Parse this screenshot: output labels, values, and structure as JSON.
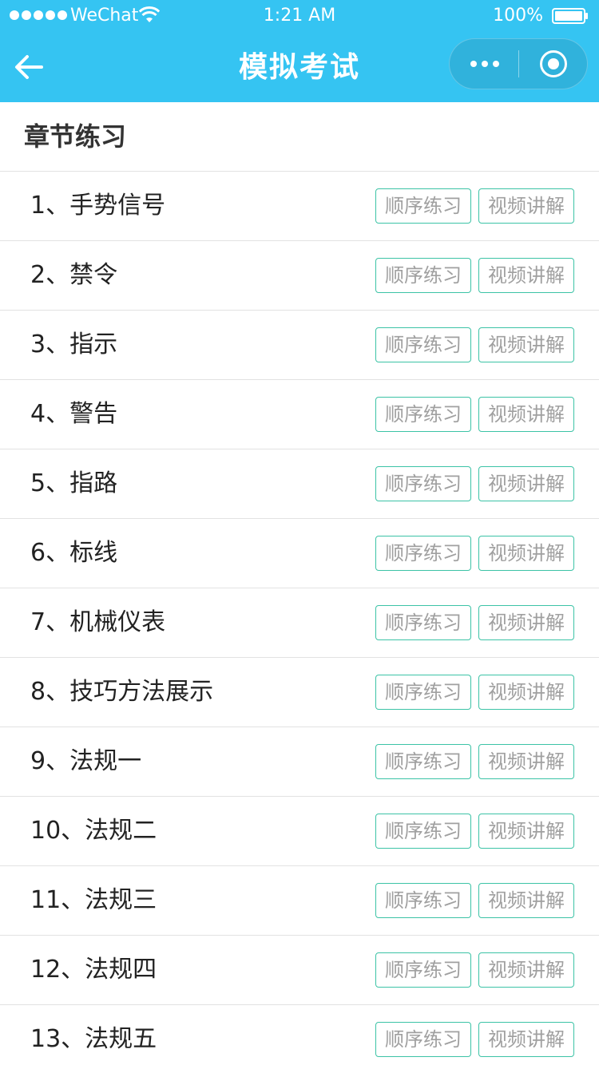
{
  "status_bar": {
    "carrier": "WeChat",
    "time": "1:21 AM",
    "battery": "100%"
  },
  "nav": {
    "title": "模拟考试"
  },
  "section": {
    "title": "章节练习"
  },
  "buttons": {
    "practice": "顺序练习",
    "video": "视频讲解"
  },
  "chapters": [
    "1、手势信号",
    "2、禁令",
    "3、指示",
    "4、警告",
    "5、指路",
    "6、标线",
    "7、机械仪表",
    "8、技巧方法展示",
    "9、法规一",
    "10、法规二",
    "11、法规三",
    "12、法规四",
    "13、法规五"
  ],
  "colors": {
    "header": "#35c4f2",
    "button_border": "#3cc3a6",
    "button_text": "#a0a0a0",
    "divider": "#e2e2e2"
  },
  "icons": {
    "back": "arrow-left-icon",
    "more": "more-dots-icon",
    "close": "target-close-icon",
    "wifi": "wifi-icon",
    "battery": "battery-icon",
    "signal": "signal-dots-icon"
  }
}
